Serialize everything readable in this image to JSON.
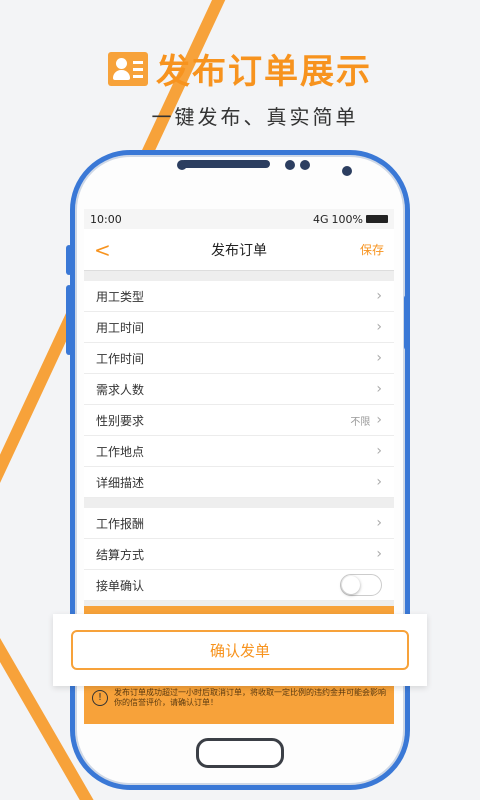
{
  "banner": {
    "title": "发布订单展示",
    "subtitle": "一键发布、真实简单"
  },
  "status_bar": {
    "time": "10:00",
    "signal": "4G",
    "battery": "100%"
  },
  "navbar": {
    "back": "<",
    "title": "发布订单",
    "save": "保存"
  },
  "form": {
    "group1": [
      {
        "label": "用工类型",
        "value": ""
      },
      {
        "label": "用工时间",
        "value": ""
      },
      {
        "label": "工作时间",
        "value": ""
      },
      {
        "label": "需求人数",
        "value": ""
      },
      {
        "label": "性别要求",
        "value": "不限"
      },
      {
        "label": "工作地点",
        "value": ""
      },
      {
        "label": "详细描述",
        "value": ""
      }
    ],
    "group2": [
      {
        "label": "工作报酬",
        "value": ""
      },
      {
        "label": "结算方式",
        "value": ""
      }
    ],
    "confirm_toggle": {
      "label": "接单确认",
      "on": false
    }
  },
  "confirm_button": "确认发单",
  "notice": {
    "icon": "!",
    "text": "发布订单成功超过一小时后取消订单，将收取一定比例的违约金并可能会影响你的信誉评价，请确认订单！"
  },
  "colors": {
    "accent": "#f7931e",
    "phone_frame": "#3a78d6"
  }
}
